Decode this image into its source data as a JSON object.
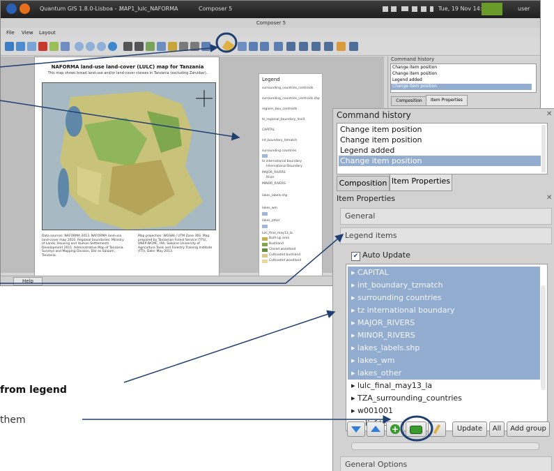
{
  "taskbar": {
    "app1": "Quantum GIS 1.8.0-Lisboa - ...",
    "app2": "MAP1_lulc_NAFORMA",
    "app3": "Composer 5",
    "clock": "Tue, 19 Nov 14:06",
    "user": "user"
  },
  "window": {
    "title": "Composer 5"
  },
  "menu": {
    "file": "File",
    "view": "View",
    "layout": "Layout"
  },
  "map": {
    "title": "NAFORMA land-use land-cover (LULC) map for Tanzania",
    "subtitle": "This map shows broad land-use and/or land-cover classes in Tanzania (excluding Zanzibar).",
    "data_sources": "Data sources: NAFORMA 2013. NAFORMA land-use land-cover map 2010. Regional boundaries: Ministry of Lands, Housing and Human Settlements Development 2011. Administrative Map of Tanzania. Surveys and Mapping Division, Dar es Salaam, Tanzania.",
    "projection": "Map projection: WGS84 / UTM Zone 36S. Map prepared by Tanzanian Forest Service (TFS), UNEP-WCMC, IRA, Sokoine University of Agriculture Tools and Forestry Training Institute (FTI), Date: May 2013."
  },
  "legend": {
    "title": "Legend",
    "items": [
      "surrounding_countries_centroids",
      "surrounding_countries_centroids.shp",
      "regions_bou_centroids",
      "tz_regional_boundary_line3",
      "CAPITAL",
      "int_boundary_tzmatch",
      "surrounding countries",
      "tz international boundary",
      "International Boundary",
      "MAJOR_RIVERS",
      "River",
      "MINOR_RIVERS",
      "lakes_labels.shp",
      "lakes_wm",
      "lakes_other",
      "lulc_final_may13_la",
      "Built-up area",
      "Bushland",
      "Closed woodland",
      "Cultivated bushland",
      "Cultivated woodland"
    ]
  },
  "small_panel": {
    "header": "Command history",
    "items": [
      "Change item position",
      "Change item position",
      "Legend added",
      "Change item position"
    ],
    "tab1": "Composition",
    "tab2": "Item Properties"
  },
  "status": {
    "help": "Help"
  },
  "zoom": {
    "command_history_label": "Command history",
    "history": [
      "Change item position",
      "Change item position",
      "Legend added",
      "Change item position"
    ],
    "tab_composition": "Composition",
    "tab_item_properties": "Item Properties",
    "item_properties_label": "Item Properties",
    "general_label": "General",
    "legend_items_label": "Legend items",
    "auto_update_label": "Auto Update",
    "auto_update_checked": true,
    "tree_selected": [
      "CAPITAL",
      "int_boundary_tzmatch",
      "surrounding countries",
      "tz international boundary",
      "MAJOR_RIVERS",
      "MINOR_RIVERS",
      "lakes_labels.shp",
      "lakes_wm",
      "lakes_other"
    ],
    "tree_unselected": [
      "lulc_final_may13_la",
      "TZA_surrounding_countries",
      "w001001",
      "relief-tz"
    ],
    "update_label": "Update",
    "all_label": "All",
    "add_group_label": "Add group",
    "general_options_label": "General Options"
  },
  "callouts": {
    "line1": "from legend",
    "line2": "them"
  },
  "colors": {
    "selection": "#93add0",
    "accent_circle": "#1f3f73",
    "arrow": "#1f3f73"
  }
}
